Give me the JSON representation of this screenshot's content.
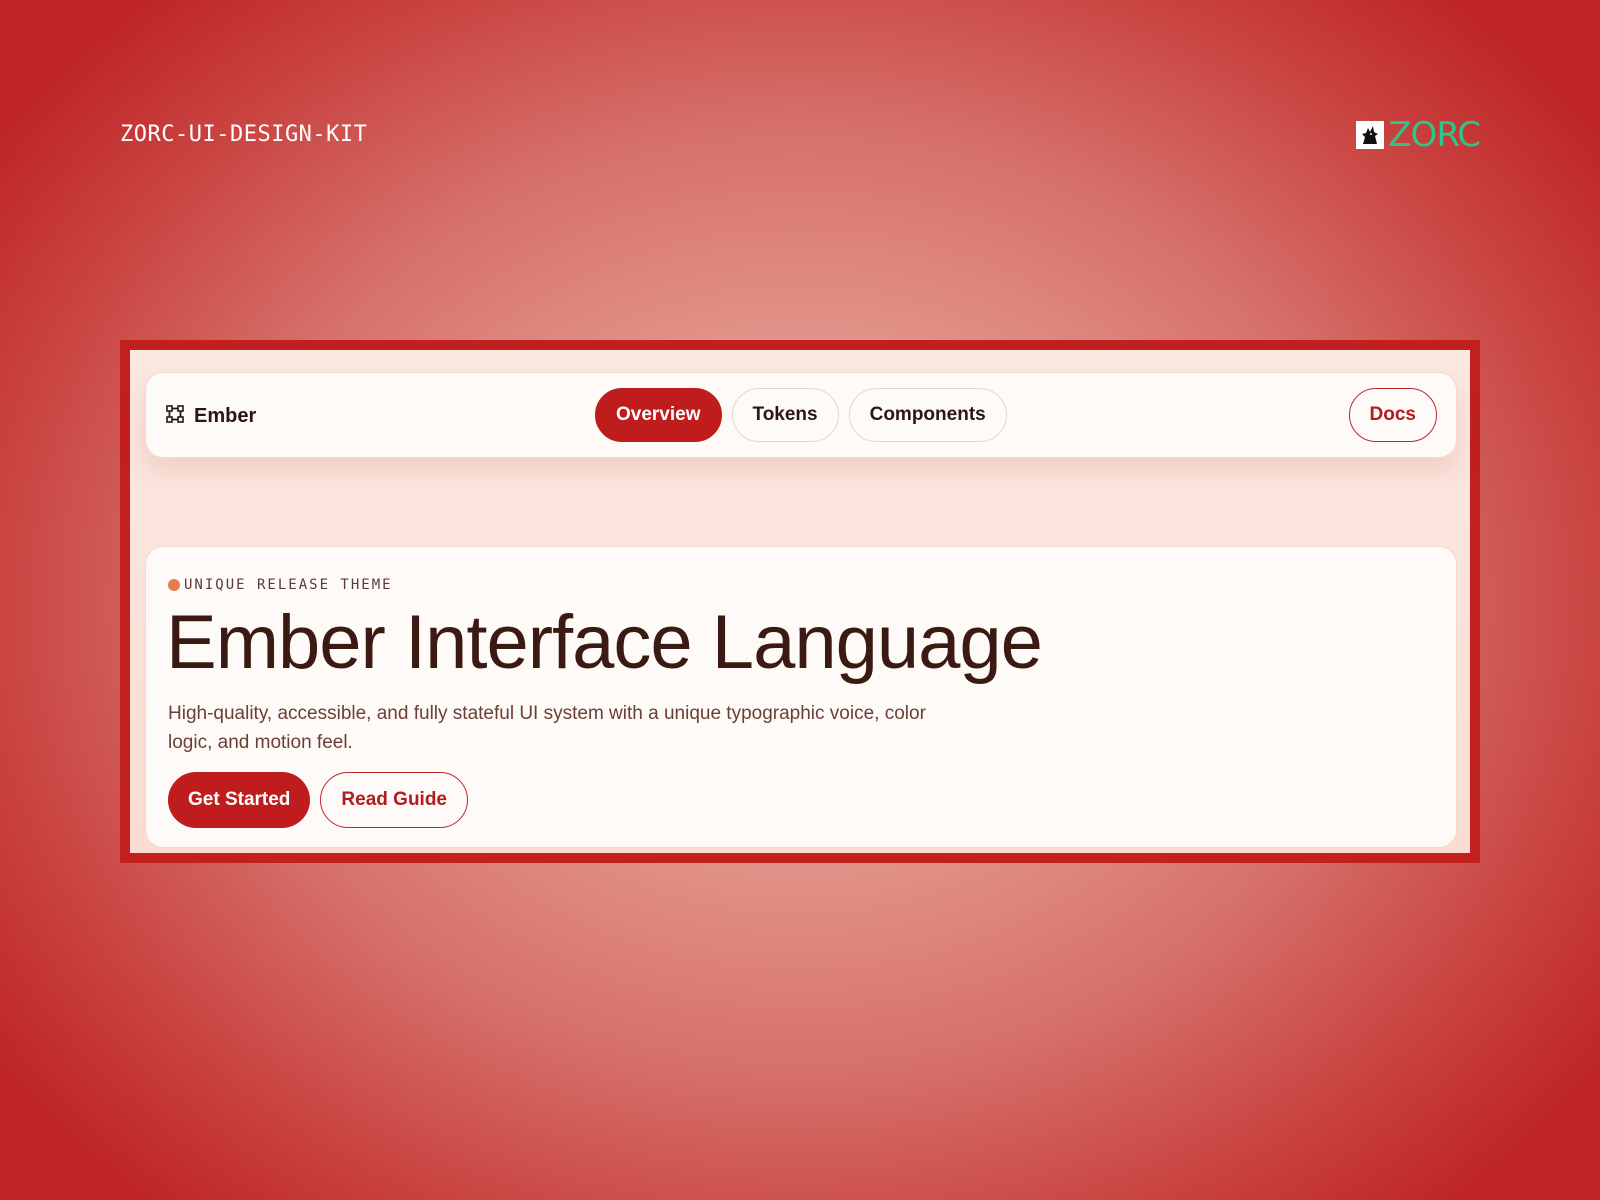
{
  "page": {
    "kit_label": "ZORC-UI-DESIGN-KIT",
    "brand": {
      "text": "ZORC",
      "icon": "wolf-logo-icon",
      "color": "#2dc58a"
    }
  },
  "navbar": {
    "logo": {
      "label": "Ember",
      "icon": "vector-frame-icon"
    },
    "tabs": [
      {
        "label": "Overview",
        "active": true
      },
      {
        "label": "Tokens",
        "active": false
      },
      {
        "label": "Components",
        "active": false
      }
    ],
    "docs_label": "Docs"
  },
  "hero": {
    "eyebrow": "UNIQUE RELEASE THEME",
    "title": "Ember Interface Language",
    "description": "High-quality, accessible, and fully stateful UI system with a unique typographic voice, color logic, and motion feel.",
    "primary_cta": "Get Started",
    "secondary_cta": "Read Guide"
  },
  "colors": {
    "accent": "#bf1d1d",
    "frame_border": "#c21f1f",
    "eyebrow_dot": "#e67b4d",
    "text_dark": "#3a1a13"
  }
}
